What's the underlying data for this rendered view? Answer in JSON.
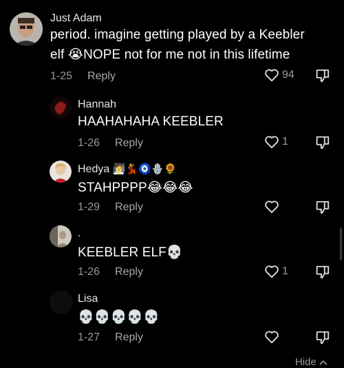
{
  "comments": [
    {
      "username": "Just Adam",
      "text_line1": "period. imagine getting played by a Keebler",
      "text_line2_pre": "elf",
      "text_line2_emoji": "😭",
      "text_line2_post": "NOPE not for me not in this lifetime",
      "date": "1-25",
      "reply": "Reply",
      "likes": "94"
    },
    {
      "username": "Hannah",
      "text": "HAAHAHAHA KEEBLER",
      "date": "1-26",
      "reply": "Reply",
      "likes": "1"
    },
    {
      "username": "Hedya",
      "username_emojis": "🧖‍♀️💃🧿🪬🌻",
      "text": "STAHPPPP",
      "text_emojis": "😂😂😂",
      "date": "1-29",
      "reply": "Reply",
      "likes": ""
    },
    {
      "username": ".",
      "text": "KEEBLER ELF",
      "text_emojis": "💀",
      "date": "1-26",
      "reply": "Reply",
      "likes": "1"
    },
    {
      "username": "Lisa",
      "text_emojis": "💀💀💀💀💀",
      "date": "1-27",
      "reply": "Reply",
      "likes": ""
    }
  ],
  "hide_label": "Hide",
  "icons": {
    "like": "heart-outline-icon",
    "dislike": "thumbs-down-outline-icon"
  }
}
